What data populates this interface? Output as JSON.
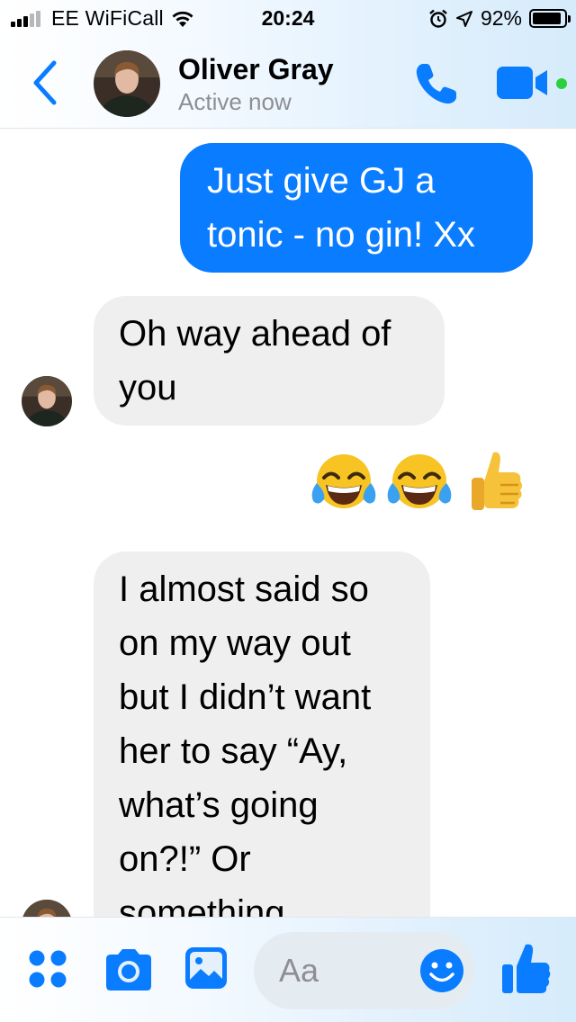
{
  "status_bar": {
    "carrier": "EE WiFiCall",
    "time": "20:24",
    "battery_percent": "92%",
    "battery_level": 0.92,
    "icons": [
      "signal-bars-icon",
      "wifi-icon",
      "alarm-icon",
      "location-arrow-icon",
      "battery-icon"
    ]
  },
  "header": {
    "contact_name": "Oliver Gray",
    "contact_status": "Active now",
    "icons": [
      "back-chevron-icon",
      "phone-icon",
      "video-camera-icon"
    ],
    "online_color": "#2ad03d"
  },
  "messages": [
    {
      "direction": "outgoing",
      "text": "Just give GJ a\ntonic - no gin! Xx"
    },
    {
      "direction": "incoming",
      "text": "Oh way ahead of\nyou"
    },
    {
      "direction": "outgoing",
      "emojis": [
        "face-with-tears-of-joy",
        "face-with-tears-of-joy",
        "thumbs-up"
      ]
    },
    {
      "direction": "incoming",
      "text": "I almost said so\non my way out\nbut I didn’t want\nher to say “Ay,\nwhat’s going\non?!” Or\nsomething"
    }
  ],
  "composer": {
    "placeholder": "Aa",
    "icons": [
      "four-dots-menu-icon",
      "camera-icon",
      "gallery-icon",
      "smiley-icon",
      "thumbs-up-icon"
    ]
  },
  "colors": {
    "accent": "#0a7cff",
    "outgoing_bubble": "#0a7cff",
    "incoming_bubble": "#efefef"
  }
}
